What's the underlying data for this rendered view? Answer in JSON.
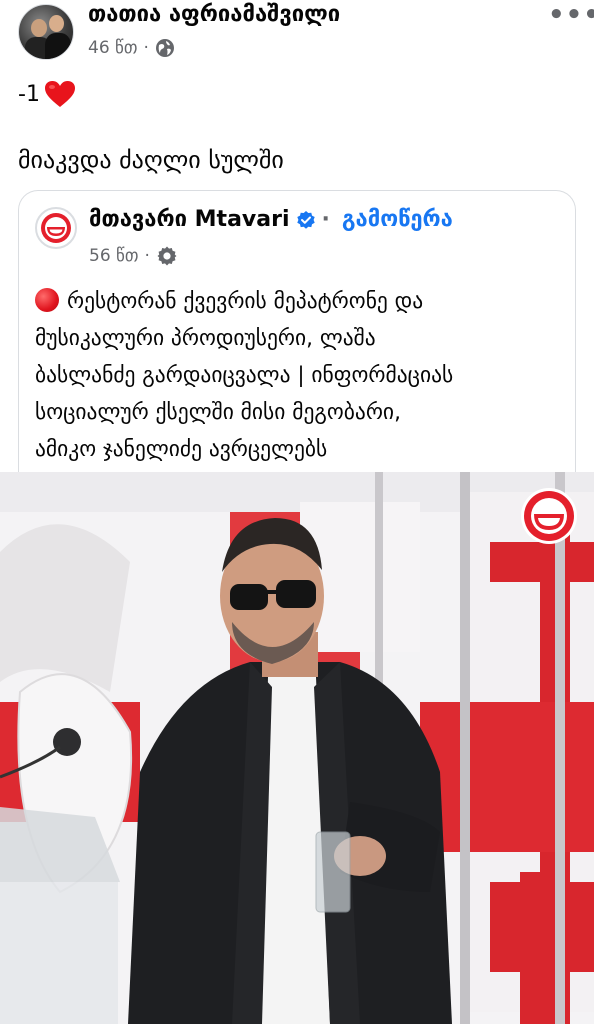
{
  "post": {
    "author": "თათია აფრიამაშვილი",
    "time": "46 წთ",
    "reaction_text": "-1",
    "reaction_icon": "red-heart-icon",
    "text": "მიაკვდა ძაღლი სულში"
  },
  "shared": {
    "page_name": "მთავარი Mtavari",
    "follow_label": "გამოწერა",
    "time": "56 წთ",
    "body": "რესტორან ქვევრის მეპატრონე და მუსიკალური პროდიუსერი, ლაშა ბასლანძე გარდაიცვალა | ინფორმაციას სოციალურ ქსელში მისი მეგობარი, ამიკო ჯანელიძე ავრცელებს",
    "body_lines": [
      "რესტორან ქვევრის მეპატრონე და",
      "მუსიკალური პროდიუსერი, ლაშა",
      "ბასლანძე გარდაიცვალა | ინფორმაციას",
      "სოციალურ ქსელში მისი მეგობარი,",
      "ამიკო ჯანელიძე ავრცელებს"
    ]
  },
  "icons": {
    "globe": "globe-icon",
    "gear": "gear-icon",
    "verified": "verified-badge-icon",
    "more": "more-options-icon"
  },
  "colors": {
    "accent": "#1877f2",
    "mtavari_red": "#e4202c",
    "meta_gray": "#65676b"
  }
}
